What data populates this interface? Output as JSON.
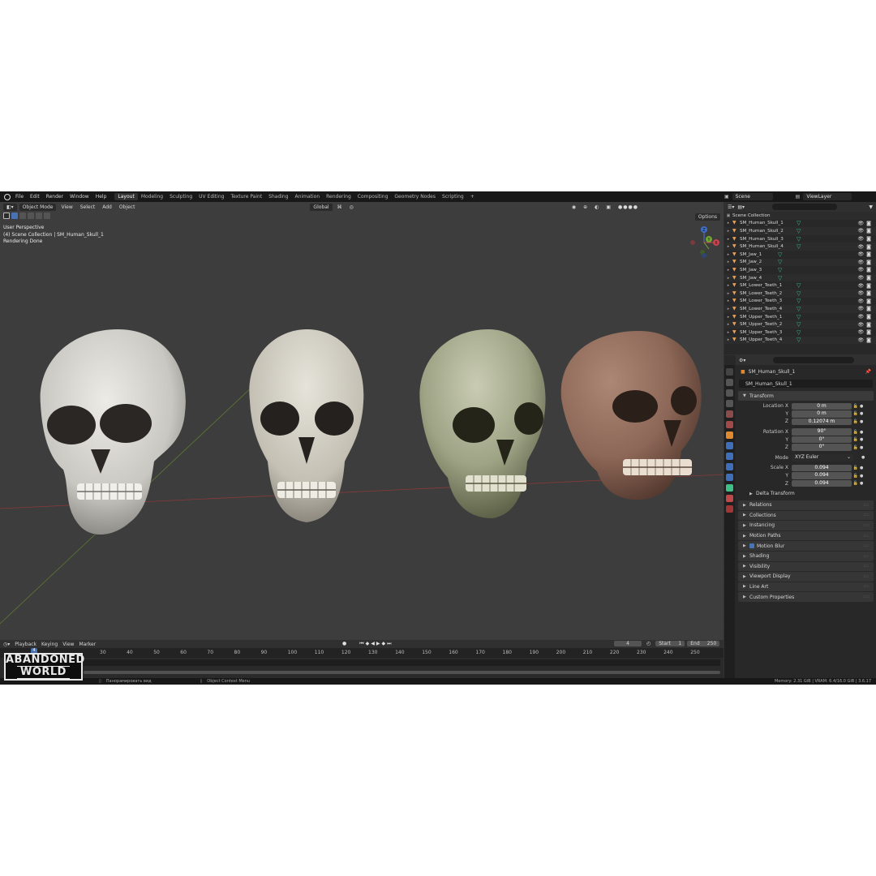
{
  "topbar": {
    "menus": [
      "File",
      "Edit",
      "Render",
      "Window",
      "Help"
    ],
    "workspaces": [
      "Layout",
      "Modeling",
      "Sculpting",
      "UV Editing",
      "Texture Paint",
      "Shading",
      "Animation",
      "Rendering",
      "Compositing",
      "Geometry Nodes",
      "Scripting"
    ],
    "active_workspace": "Layout",
    "add_tab": "+",
    "scene": "Scene",
    "view_layer": "ViewLayer"
  },
  "viewport": {
    "mode": "Object Mode",
    "menus": [
      "View",
      "Select",
      "Add",
      "Object"
    ],
    "transform": "Global",
    "options": "Options",
    "info_line1": "User Perspective",
    "info_line2": "(4) Scene Collection | SM_Human_Skull_1",
    "info_line3": "Rendering Done",
    "gizmo_labels": {
      "z": "Z",
      "y": "Y",
      "x": "X"
    },
    "accent": "#4772b3"
  },
  "timeline": {
    "menus": [
      "Playback",
      "Keying",
      "View",
      "Marker"
    ],
    "current_frame": "4",
    "start_label": "Start",
    "start": "1",
    "end_label": "End",
    "end": "250",
    "ticks": [
      "30",
      "40",
      "50",
      "60",
      "70",
      "80",
      "90",
      "100",
      "110",
      "120",
      "130",
      "140",
      "150",
      "160",
      "170",
      "180",
      "190",
      "200",
      "210",
      "220",
      "230",
      "240",
      "250"
    ]
  },
  "statusbar": {
    "hint1": "Панорамировать вид",
    "hint2": "Object Context Menu",
    "memory": "Memory: 2.31 GiB | VRAM: 6.4/16.0 GiB | 3.6.17"
  },
  "logo": {
    "line1": "ABANDONED",
    "line2": "WORLD"
  },
  "outliner": {
    "root": "Scene Collection",
    "items": [
      "SM_Human_Skull_1",
      "SM_Human_Skull_2",
      "SM_Human_Skull_3",
      "SM_Human_Skull_4",
      "SM_Jaw_1",
      "SM_Jaw_2",
      "SM_Jaw_3",
      "SM_Jaw_4",
      "SM_Lower_Teeth_1",
      "SM_Lower_Teeth_2",
      "SM_Lower_Teeth_3",
      "SM_Lower_Teeth_4",
      "SM_Upper_Teeth_1",
      "SM_Upper_Teeth_2",
      "SM_Upper_Teeth_3",
      "SM_Upper_Teeth_4"
    ]
  },
  "properties": {
    "object_title": "SM_Human_Skull_1",
    "object_name": "SM_Human_Skull_1",
    "transform_label": "Transform",
    "location": {
      "label": "Location X",
      "x": "0 m",
      "y": "0 m",
      "z": "0.12074 m"
    },
    "rotation": {
      "label": "Rotation X",
      "x": "90°",
      "y": "0°",
      "z": "0°"
    },
    "mode_label": "Mode",
    "mode_value": "XYZ Euler",
    "scale": {
      "label": "Scale X",
      "x": "0.094",
      "y": "0.094",
      "z": "0.094"
    },
    "axis_y": "Y",
    "axis_z": "Z",
    "delta_transform": "Delta Transform",
    "panels": [
      "Relations",
      "Collections",
      "Instancing",
      "Motion Paths",
      "Motion Blur",
      "Shading",
      "Visibility",
      "Viewport Display",
      "Line Art",
      "Custom Properties"
    ]
  }
}
